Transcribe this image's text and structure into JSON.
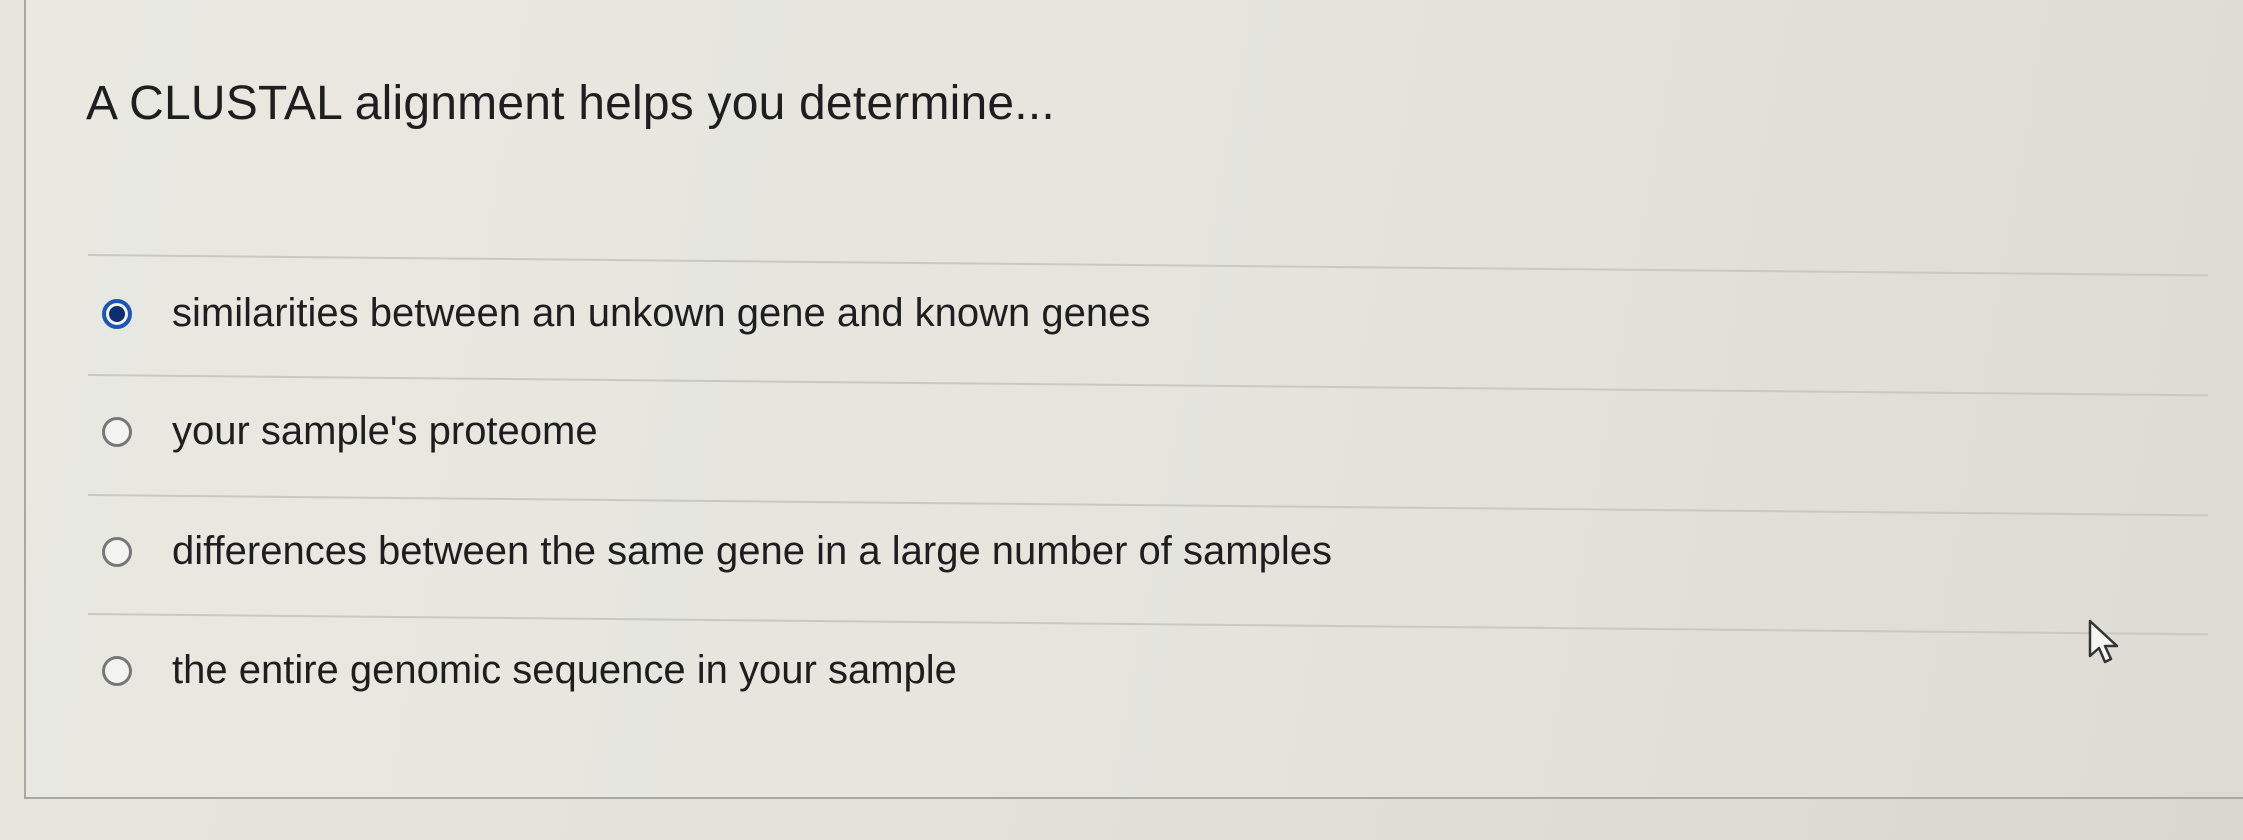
{
  "question": {
    "text": "A CLUSTAL alignment helps you determine..."
  },
  "options": [
    {
      "label": "similarities between an unkown gene and known genes",
      "selected": true
    },
    {
      "label": "your sample's proteome",
      "selected": false
    },
    {
      "label": "differences between the same gene in a large number of samples",
      "selected": false
    },
    {
      "label": "the entire genomic sequence in your sample",
      "selected": false
    }
  ],
  "colors": {
    "selected_radio": "#1a56b4",
    "background": "#e5e5de"
  },
  "icons": {
    "cursor": "mouse-pointer-icon"
  }
}
